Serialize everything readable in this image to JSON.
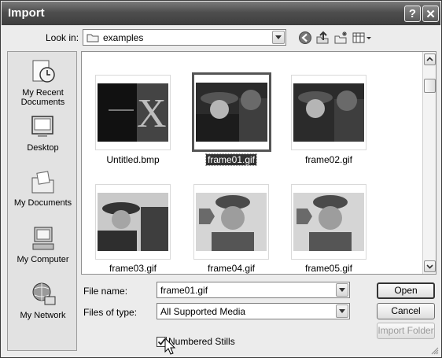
{
  "window": {
    "title": "Import",
    "help_glyph": "?",
    "close_glyph": "✕"
  },
  "toolbar": {
    "look_in_label": "Look in:",
    "look_in_value": "examples",
    "icons": [
      "back-icon",
      "up-folder-icon",
      "new-folder-icon",
      "view-menu-icon"
    ]
  },
  "places": [
    {
      "label": "My Recent Documents",
      "icon": "recent-documents-icon"
    },
    {
      "label": "Desktop",
      "icon": "desktop-icon"
    },
    {
      "label": "My Documents",
      "icon": "my-documents-icon"
    },
    {
      "label": "My Computer",
      "icon": "my-computer-icon"
    },
    {
      "label": "My Network",
      "icon": "my-network-icon"
    }
  ],
  "files": [
    {
      "name": "Untitled.bmp",
      "selected": false
    },
    {
      "name": "frame01.gif",
      "selected": true
    },
    {
      "name": "frame02.gif",
      "selected": false
    },
    {
      "name": "frame03.gif",
      "selected": false
    },
    {
      "name": "frame04.gif",
      "selected": false
    },
    {
      "name": "frame05.gif",
      "selected": false
    }
  ],
  "fields": {
    "file_name_label": "File name:",
    "file_name_value": "frame01.gif",
    "files_of_type_label": "Files of type:",
    "files_of_type_value": "All Supported Media"
  },
  "buttons": {
    "open": "Open",
    "cancel": "Cancel",
    "import_folder": "Import Folder"
  },
  "options": {
    "numbered_stills_label": "Numbered Stills",
    "numbered_stills_checked": true
  }
}
